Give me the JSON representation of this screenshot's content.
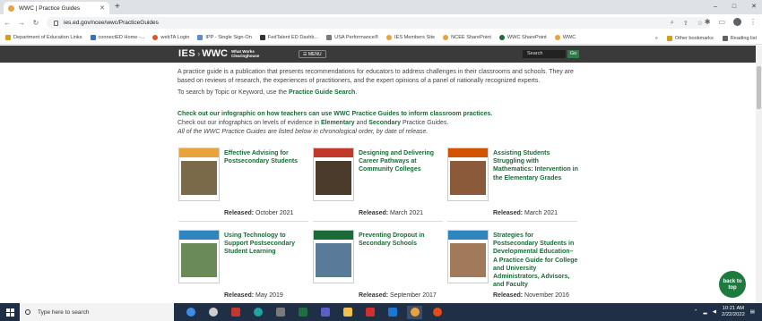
{
  "browser": {
    "tab_title": "WWC | Practice Guides",
    "new_tab": "+",
    "url": "ies.ed.gov/ncee/wwc/PracticeGuides",
    "window_controls": [
      "–",
      "□",
      "✕"
    ],
    "bookmarks": [
      {
        "label": "Department of Education Links",
        "color": "#d4a017"
      },
      {
        "label": "connectED Home -...",
        "color": "#3b6fb6"
      },
      {
        "label": "webTA Login",
        "color": "#d9552a"
      },
      {
        "label": "IPP - Single Sign-On",
        "color": "#5b8bd6"
      },
      {
        "label": "FedTalent ED Dashb...",
        "color": "#333333"
      },
      {
        "label": "USA Performance®",
        "color": "#7a7a7a"
      },
      {
        "label": "IES Members Site",
        "color": "#e8a33b"
      },
      {
        "label": "NCEE SharePoint",
        "color": "#e8a33b"
      },
      {
        "label": "WWC SharePoint",
        "color": "#1a6b35"
      },
      {
        "label": "WWC",
        "color": "#e8a33b"
      }
    ],
    "other_bookmarks": "Other bookmarks",
    "reading_list": "Reading list"
  },
  "site": {
    "logo_ies": "IES",
    "logo_wwc": "WWC",
    "logo_sub": "What Works Clearinghouse",
    "menu_label": "☰ MENU",
    "search_placeholder": "Search",
    "go_label": "Go"
  },
  "intro": {
    "p1": "A practice guide is a publication that presents recommendations for educators to address challenges in their classrooms and schools. They are based on reviews of research, the experiences of practitioners, and the expert opinions of a panel of nationally recognized experts.",
    "p2_pre": "To search by Topic or Keyword, use the ",
    "p2_link": "Practice Guide Search",
    "p2_post": ".",
    "cta": "Check out our infographic on how teachers can use WWC Practice Guides to inform classroom practices.",
    "levels_pre": "Check out our infographics on levels of evidence in ",
    "levels_link1": "Elementary",
    "levels_mid": " and ",
    "levels_link2": "Secondary",
    "levels_post": " Practice Guides.",
    "chrono": "All of the WWC Practice Guides are listed below in chronological order, by date of release."
  },
  "guides": [
    {
      "title": "Effective Advising for Postsecondary Students",
      "released_label": "Released:",
      "date": "October 2021",
      "band": "#e8a33b",
      "img": "#7b6a4a"
    },
    {
      "title": "Designing and Delivering Career Pathways at Community Colleges",
      "released_label": "Released:",
      "date": "March 2021",
      "band": "#c0392b",
      "img": "#4a3b2a"
    },
    {
      "title": "Assisting Students Struggling with Mathematics: Intervention in the Elementary Grades",
      "released_label": "Released:",
      "date": "March 2021",
      "band": "#d35400",
      "img": "#8a5a3a"
    },
    {
      "title": "Using Technology to Support Postsecondary Student Learning",
      "released_label": "Released:",
      "date": "May 2019",
      "band": "#2e86c1",
      "img": "#6a8a5a"
    },
    {
      "title": "Preventing Dropout in Secondary Schools",
      "released_label": "Released:",
      "date": "September 2017",
      "band": "#1a6b35",
      "img": "#5a7a9a"
    },
    {
      "title": "Strategies for Postsecondary Students in Developmental Education– A Practice Guide for College and University Administrators, Advisors, and Faculty",
      "released_label": "Released:",
      "date": "November 2016",
      "band": "#2e86c1",
      "img": "#a07a5a"
    }
  ],
  "back_to_top": "back to top",
  "taskbar": {
    "search_placeholder": "Type here to search",
    "apps": [
      {
        "name": "edge-icon",
        "color": "#3a8ee6"
      },
      {
        "name": "chrome-alt-icon",
        "color": "#cfcfcf"
      },
      {
        "name": "calendar-icon",
        "color": "#c0392b"
      },
      {
        "name": "edge-new-icon",
        "color": "#1fa3a3"
      },
      {
        "name": "calculator-icon",
        "color": "#7a7a7a"
      },
      {
        "name": "excel-icon",
        "color": "#1d6f42"
      },
      {
        "name": "teams-icon",
        "color": "#5b5fc7"
      },
      {
        "name": "folder-icon",
        "color": "#f0c14b"
      },
      {
        "name": "acrobat-icon",
        "color": "#d32f2f"
      },
      {
        "name": "outlook-icon",
        "color": "#1976d2"
      },
      {
        "name": "chrome-icon",
        "color": "#e8a33b"
      },
      {
        "name": "app-icon",
        "color": "#e64a19"
      }
    ],
    "time": "10:21 AM",
    "date": "2/22/2022"
  }
}
